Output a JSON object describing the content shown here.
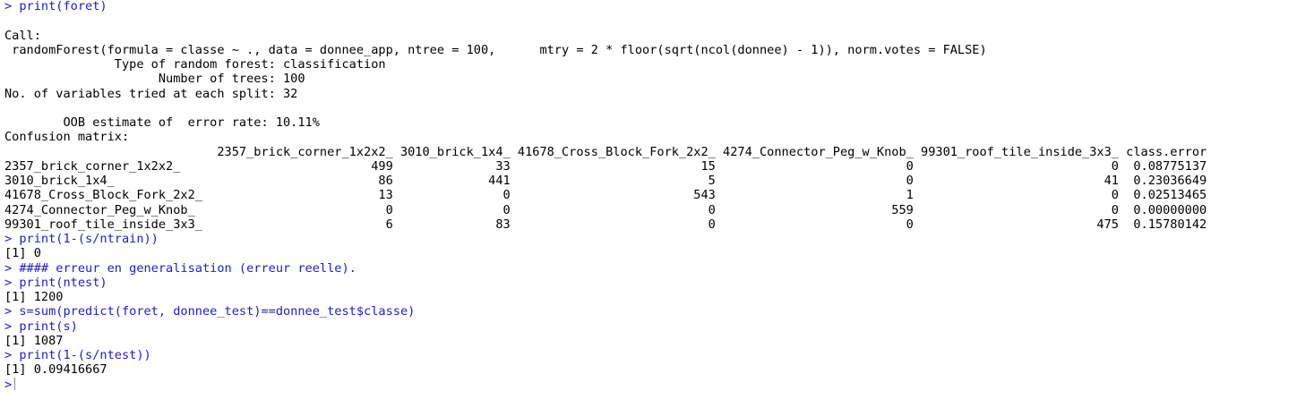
{
  "console": {
    "prompt_symbol": ">",
    "colors": {
      "command": "#1c1cd2",
      "output": "#000000",
      "background": "#ffffff"
    },
    "lines": [
      {
        "kind": "cmd",
        "text": "> print(foret)"
      },
      {
        "kind": "out",
        "text": ""
      },
      {
        "kind": "out",
        "text": "Call:"
      },
      {
        "kind": "out",
        "text": " randomForest(formula = classe ~ ., data = donnee_app, ntree = 100,      mtry = 2 * floor(sqrt(ncol(donnee) - 1)), norm.votes = FALSE)"
      },
      {
        "kind": "out",
        "text": "               Type of random forest: classification"
      },
      {
        "kind": "out",
        "text": "                     Number of trees: 100"
      },
      {
        "kind": "out",
        "text": "No. of variables tried at each split: 32"
      },
      {
        "kind": "out",
        "text": ""
      },
      {
        "kind": "out",
        "text": "        OOB estimate of  error rate: 10.11%"
      },
      {
        "kind": "out",
        "text": "Confusion matrix:"
      },
      {
        "kind": "out",
        "text": "                             2357_brick_corner_1x2x2_ 3010_brick_1x4_ 41678_Cross_Block_Fork_2x2_ 4274_Connector_Peg_w_Knob_ 99301_roof_tile_inside_3x3_ class.error"
      },
      {
        "kind": "out",
        "text": "2357_brick_corner_1x2x2_                          499              33                          15                          0                           0  0.08775137"
      },
      {
        "kind": "out",
        "text": "3010_brick_1x4_                                    86             441                           5                          0                          41  0.23036649"
      },
      {
        "kind": "out",
        "text": "41678_Cross_Block_Fork_2x2_                        13               0                         543                          1                           0  0.02513465"
      },
      {
        "kind": "out",
        "text": "4274_Connector_Peg_w_Knob_                          0               0                           0                        559                           0  0.00000000"
      },
      {
        "kind": "out",
        "text": "99301_roof_tile_inside_3x3_                         6              83                           0                          0                         475  0.15780142"
      },
      {
        "kind": "cmd",
        "text": "> print(1-(s/ntrain))"
      },
      {
        "kind": "out",
        "text": "[1] 0"
      },
      {
        "kind": "cmd",
        "text": "> #### erreur en generalisation (erreur reelle)."
      },
      {
        "kind": "cmd",
        "text": "> print(ntest)"
      },
      {
        "kind": "out",
        "text": "[1] 1200"
      },
      {
        "kind": "cmd",
        "text": "> s=sum(predict(foret, donnee_test)==donnee_test$classe)"
      },
      {
        "kind": "cmd",
        "text": "> print(s)"
      },
      {
        "kind": "out",
        "text": "[1] 1087"
      },
      {
        "kind": "cmd",
        "text": "> print(1-(s/ntest))"
      },
      {
        "kind": "out",
        "text": "[1] 0.09416667"
      }
    ],
    "input_prompt": ">"
  }
}
